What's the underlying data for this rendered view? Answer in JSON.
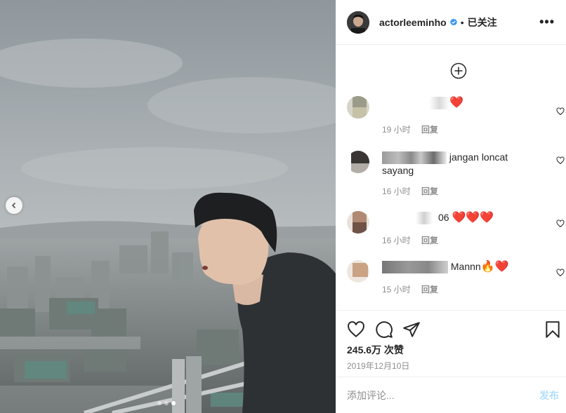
{
  "post": {
    "username": "actorleeminho",
    "separator": "•",
    "follow_label": "已关注",
    "more_label": "•••",
    "likes": "245.6万 次赞",
    "date": "2019年12月10日"
  },
  "comments": [
    {
      "text_visible": "",
      "emoji": "❤️",
      "time": "19 小时",
      "reply_label": "回复"
    },
    {
      "text_visible": "jangan loncat",
      "text_line2": "sayang",
      "time": "16 小时",
      "reply_label": "回复"
    },
    {
      "text_visible": "06",
      "emoji": "❤️❤️❤️",
      "time": "16 小时",
      "reply_label": "回复"
    },
    {
      "text_visible": "Mannn",
      "emoji": "🔥❤️",
      "time": "15 小时",
      "reply_label": "回复"
    }
  ],
  "add_comment": {
    "placeholder": "添加评论...",
    "post_label": "发布"
  },
  "carousel": {
    "current_index": 3,
    "total": 3
  },
  "icons": [
    "chevron-left-icon",
    "verified-icon",
    "more-icon",
    "load-more-icon",
    "heart-icon",
    "comment-icon",
    "share-icon",
    "bookmark-icon"
  ],
  "colors": {
    "verified": "#3897f0",
    "post_button": "#b2dffc",
    "meta": "#8e8e8e",
    "heart": "#e0102a"
  }
}
